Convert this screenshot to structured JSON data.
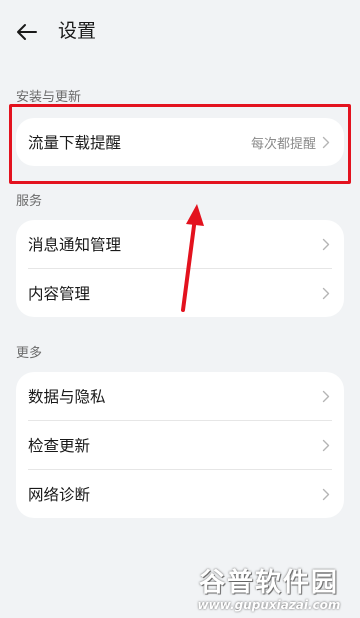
{
  "header": {
    "title": "设置"
  },
  "sections": {
    "install_update": {
      "label": "安装与更新",
      "items": [
        {
          "label": "流量下载提醒",
          "value": "每次都提醒"
        }
      ]
    },
    "services": {
      "label": "服务",
      "items": [
        {
          "label": "消息通知管理"
        },
        {
          "label": "内容管理"
        }
      ]
    },
    "more": {
      "label": "更多",
      "items": [
        {
          "label": "数据与隐私"
        },
        {
          "label": "检查更新"
        },
        {
          "label": "网络诊断"
        }
      ]
    }
  },
  "annotation": {
    "color": "#e3121e"
  },
  "watermark": {
    "title": "谷普软件园",
    "url": "www.gupuxiazai.com"
  },
  "colors": {
    "background": "#f1f3f5",
    "card": "#ffffff",
    "text_primary": "#191919",
    "text_secondary": "#8a8a8a"
  }
}
